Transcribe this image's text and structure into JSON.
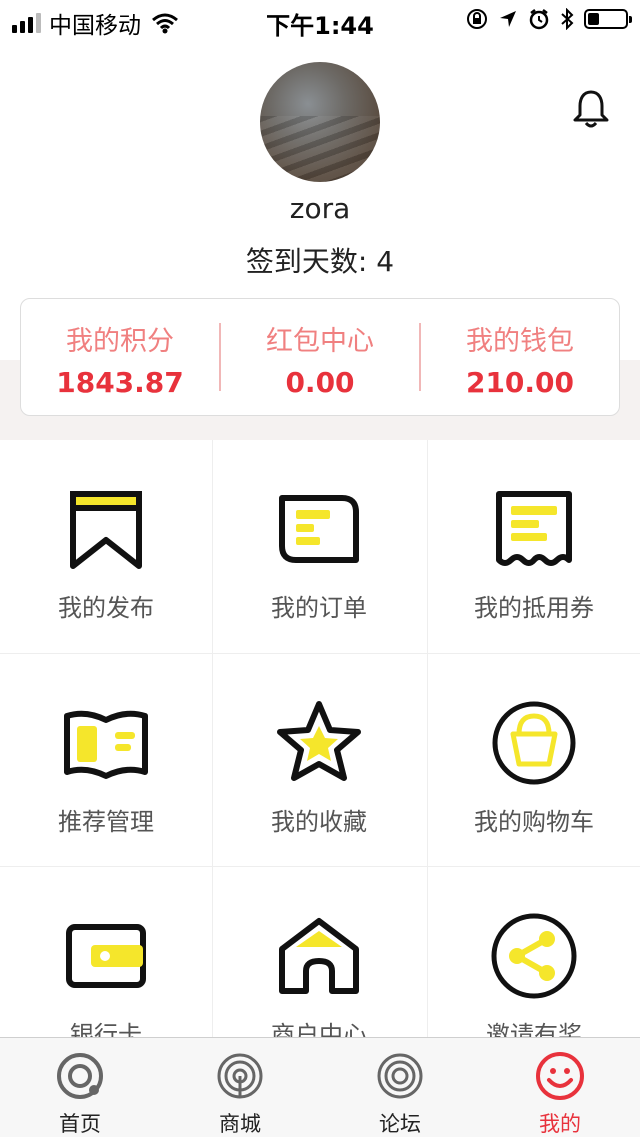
{
  "status_bar": {
    "carrier": "中国移动",
    "time": "下午1:44",
    "battery_level": 0.3
  },
  "profile": {
    "username": "zora",
    "signin_days": "签到天数: 4"
  },
  "stats": [
    {
      "label": "我的积分",
      "value": "1843.87"
    },
    {
      "label": "红包中心",
      "value": "0.00"
    },
    {
      "label": "我的钱包",
      "value": "210.00"
    }
  ],
  "menu": [
    {
      "label": "我的发布",
      "icon": "bookmark-icon"
    },
    {
      "label": "我的订单",
      "icon": "order-icon"
    },
    {
      "label": "我的抵用券",
      "icon": "coupon-icon"
    },
    {
      "label": "推荐管理",
      "icon": "book-icon"
    },
    {
      "label": "我的收藏",
      "icon": "star-icon"
    },
    {
      "label": "我的购物车",
      "icon": "shopping-bag-icon"
    },
    {
      "label": "银行卡",
      "icon": "bank-card-icon"
    },
    {
      "label": "商户中心",
      "icon": "store-icon"
    },
    {
      "label": "邀请有奖",
      "icon": "share-icon"
    }
  ],
  "tabs": [
    {
      "label": "首页",
      "icon": "home-icon"
    },
    {
      "label": "商城",
      "icon": "mall-icon"
    },
    {
      "label": "论坛",
      "icon": "forum-icon"
    },
    {
      "label": "我的",
      "icon": "smile-icon",
      "active": true
    }
  ],
  "colors": {
    "accent_red": "#e8323c",
    "label_pink": "#f08080",
    "icon_yellow": "#f5e62b",
    "icon_stroke": "#111111"
  }
}
